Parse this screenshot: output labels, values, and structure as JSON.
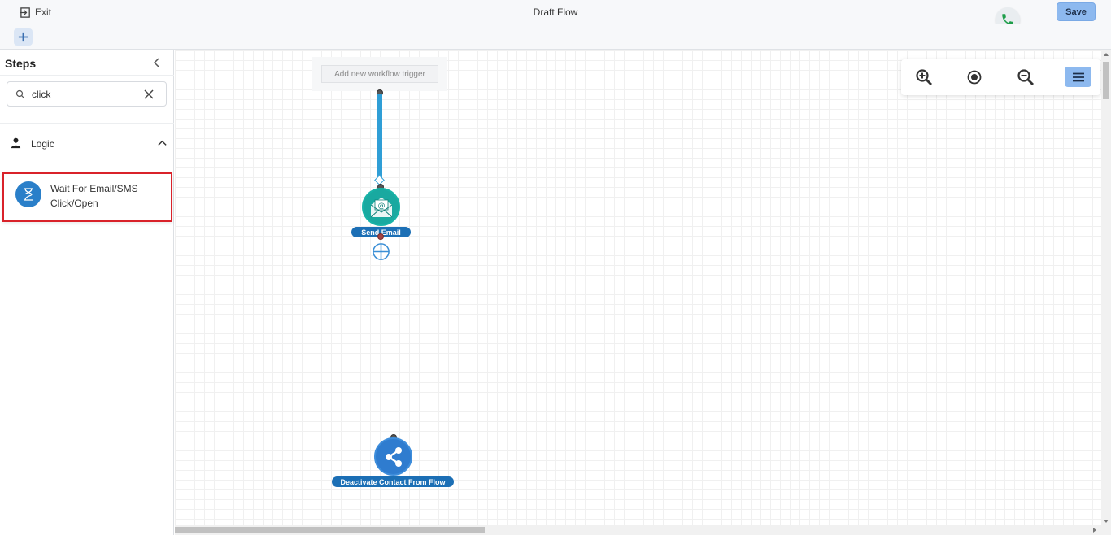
{
  "header": {
    "exit_label": "Exit",
    "title": "Draft Flow",
    "save_label": "Save"
  },
  "sidebar": {
    "title": "Steps",
    "search": {
      "value": "click",
      "placeholder": ""
    },
    "groups": [
      {
        "label": "Logic",
        "items": [
          {
            "label": "Wait For Email/SMS Click/Open"
          }
        ]
      }
    ]
  },
  "canvas": {
    "trigger_label": "Add new workflow trigger",
    "nodes": [
      {
        "label": "Send Email",
        "icon": "email-icon"
      },
      {
        "label": "Deactivate Contact From Flow",
        "icon": "share-icon"
      }
    ]
  },
  "colors": {
    "accent": "#8db9ef",
    "connector": "#2f9ed6",
    "highlight": "#d9222a",
    "email_node": "#19a9a0",
    "deactivate_node": "#2f7ccf",
    "phone": "#1e9e4a"
  }
}
